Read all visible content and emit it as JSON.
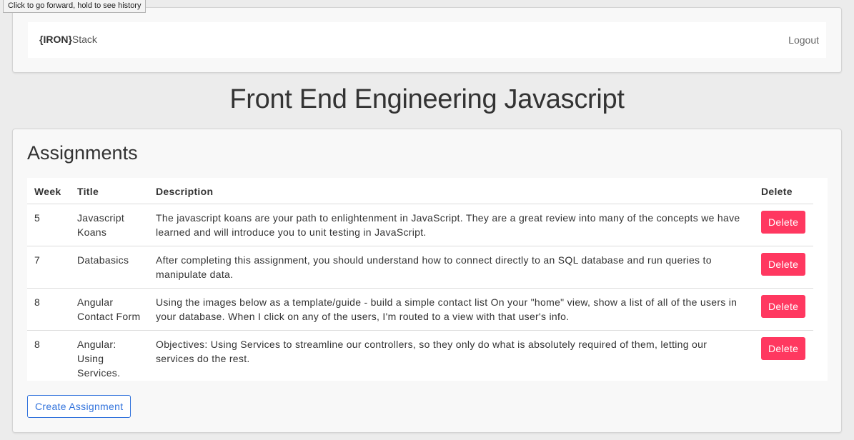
{
  "tooltip": "Click to go forward, hold to see history",
  "navbar": {
    "brand_bold": "{IRON}",
    "brand_rest": "Stack",
    "logout": "Logout"
  },
  "page_title": "Front End Engineering Javascript",
  "assignments": {
    "title": "Assignments",
    "columns": [
      "Week",
      "Title",
      "Description",
      "Delete"
    ],
    "rows": [
      {
        "week": "5",
        "title": "Javascript Koans",
        "description": "The javascript koans are your path to enlightenment in JavaScript. They are a great review into many of the concepts we have learned and will introduce you to unit testing in JavaScript.",
        "delete": "Delete"
      },
      {
        "week": "7",
        "title": "Databasics",
        "description": "After completing this assignment, you should understand how to connect directly to an SQL database and run queries to manipulate data.",
        "delete": "Delete"
      },
      {
        "week": "8",
        "title": "Angular Contact Form",
        "description": "Using the images below as a template/guide - build a simple contact list On your \"home\" view, show a list of all of the users in your database. When I click on any of the users, I'm routed to a view with that user's info.",
        "delete": "Delete"
      },
      {
        "week": "8",
        "title": "Angular: Using Services.",
        "description": "Objectives: Using Services to streamline our controllers, so they only do what is absolutely required of them, letting our services do the rest.",
        "delete": "Delete"
      }
    ],
    "create_label": "Create Assignment"
  },
  "colors": {
    "danger": "#ff3860",
    "link": "#3273dc"
  }
}
